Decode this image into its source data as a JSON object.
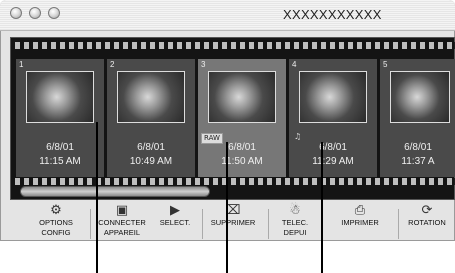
{
  "window": {
    "title": "XXXXXXXXXXX"
  },
  "frames": [
    {
      "number": "1",
      "date": "6/8/01",
      "time": "11:15 AM",
      "badge": ""
    },
    {
      "number": "2",
      "date": "6/8/01",
      "time": "10:49 AM",
      "badge": ""
    },
    {
      "number": "3",
      "date": "6/8/01",
      "time": "11:50 AM",
      "badge": "RAW"
    },
    {
      "number": "4",
      "date": "6/8/01",
      "time": "11:29 AM",
      "badge": ""
    },
    {
      "number": "5",
      "date": "6/8/01",
      "time": "11:37 A",
      "badge": ""
    }
  ],
  "toolbar": [
    {
      "icon": "options-config-icon",
      "label1": "OPTIONS",
      "label2": "CONFIG"
    },
    {
      "icon": "connect-camera-icon",
      "label1": "CONNECTER",
      "label2": "APPAREIL"
    },
    {
      "icon": "select-icon",
      "label1": "SELECT.",
      "label2": ""
    },
    {
      "icon": "delete-icon",
      "label1": "SUPPRIMER",
      "label2": ""
    },
    {
      "icon": "download-icon",
      "label1": "TELEC.",
      "label2": "DEPUI"
    },
    {
      "icon": "print-icon",
      "label1": "IMPRIMER",
      "label2": ""
    },
    {
      "icon": "rotate-icon",
      "label1": "ROTATION",
      "label2": ""
    }
  ]
}
